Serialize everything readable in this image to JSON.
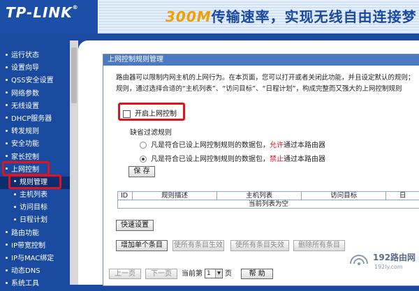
{
  "header": {
    "logo": "TP-LINK",
    "logo_reg": "®",
    "banner_num": "300M",
    "banner_text": "传输速率，实现无线自由连接梦"
  },
  "sidebar": {
    "items": [
      {
        "label": "运行状态"
      },
      {
        "label": "设置向导"
      },
      {
        "label": "QSS安全设置"
      },
      {
        "label": "网络参数"
      },
      {
        "label": "无线设置"
      },
      {
        "label": "DHCP服务器"
      },
      {
        "label": "转发规则"
      },
      {
        "label": "安全功能"
      },
      {
        "label": "家长控制"
      },
      {
        "label": "上网控制"
      },
      {
        "label": "规则管理"
      },
      {
        "label": "主机列表"
      },
      {
        "label": "访问目标"
      },
      {
        "label": "日程计划"
      },
      {
        "label": "路由功能"
      },
      {
        "label": "IP带宽控制"
      },
      {
        "label": "IP与MAC绑定"
      },
      {
        "label": "动态DNS"
      },
      {
        "label": "系统工具"
      }
    ]
  },
  "panel": {
    "title": "上网控制规则管理",
    "desc_line1": "路由器可以限制内网主机的上网行为。在本页面，您可以打开或者关闭此功能，并且设定默认的规则；",
    "desc_line2": "规则，通过选择合适的“主机列表”、“访问目标”、“日程计划”，构成完整而又强大的上网控制规则",
    "enable_label": "开启上网控制",
    "enable_checked": false,
    "filter_label": "缺省过滤规则",
    "rule_allow_pre": "凡是符合已设上网控制规则的数据包，",
    "rule_allow_key": "允许",
    "rule_allow_post": "通过本路由器",
    "rule_deny_pre": "凡是符合已设上网控制规则的数据包，",
    "rule_deny_key": "禁止",
    "rule_deny_post": "通过本路由器",
    "selected_rule": "deny",
    "save_label": "保 存",
    "table": {
      "headers": [
        "ID",
        "规则描述",
        "主机列表",
        "访问目标",
        "日"
      ],
      "empty_text": "当前列表为空"
    },
    "quick_setup_label": "快速设置",
    "add_label": "增加单个条目",
    "enable_all_label": "使所有条目生效",
    "disable_all_label": "使所有条目失效",
    "delete_all_label": "删除所有条目",
    "prev_label": "上一页",
    "next_label": "下一页",
    "page_prefix": "当前第",
    "page_value": "1",
    "page_suffix": "页",
    "help_label": "帮 助"
  },
  "watermark": {
    "brand": "192路由网",
    "url": "192ly.com"
  },
  "colors": {
    "sidebar_bg": "#1a4aa0",
    "highlight": "#e0141e",
    "panel_title_bg": "#4b79c2"
  }
}
